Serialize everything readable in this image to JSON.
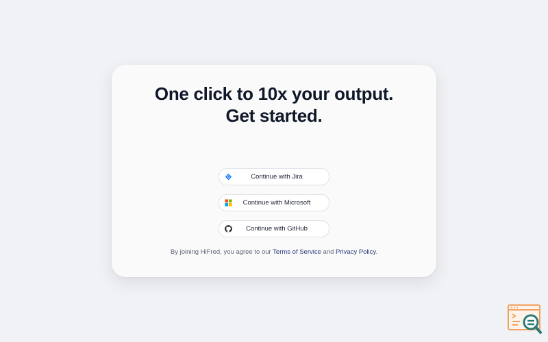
{
  "headline": {
    "line1": "One click to 10x your output.",
    "line2": "Get started."
  },
  "auth_buttons": [
    {
      "label": "Continue with Jira",
      "icon": "jira-icon"
    },
    {
      "label": "Continue with Microsoft",
      "icon": "microsoft-icon"
    },
    {
      "label": "Continue with GitHub",
      "icon": "github-icon"
    }
  ],
  "legal": {
    "prefix": "By joining HiFred, you agree to our",
    "terms_link": "Terms of Service",
    "joiner": "and",
    "privacy_link": "Privacy Policy",
    "suffix": "."
  },
  "colors": {
    "background": "#f1f2f5",
    "card": "#fafafa",
    "headline": "#0f1729",
    "link": "#2b3a78",
    "jira_blue": "#2684ff",
    "logo_orange": "#f0a263",
    "logo_teal": "#2b7a78"
  }
}
